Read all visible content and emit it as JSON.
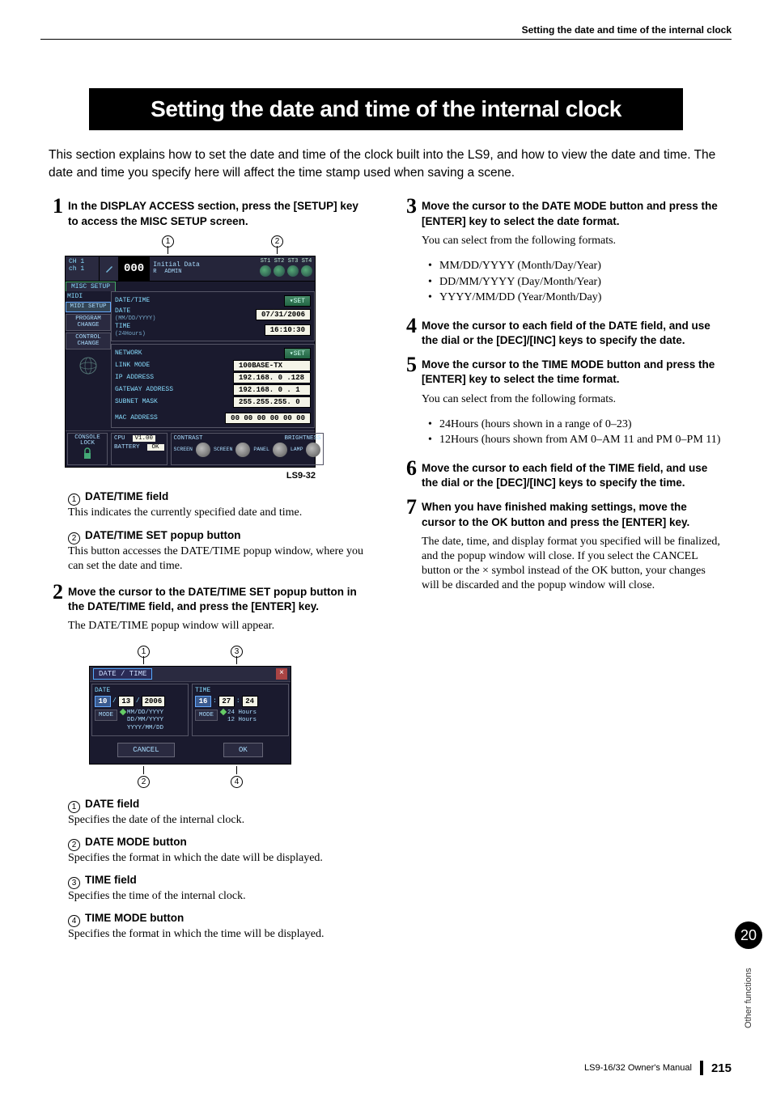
{
  "header": {
    "running": "Setting the date and time of the internal clock"
  },
  "title": "Setting the date and time of the internal clock",
  "intro": "This section explains how to set the date and time of the clock built into the LS9, and how to view the date and time. The date and time you specify here will affect the time stamp used when saving a scene.",
  "left": {
    "step1": {
      "num": "1",
      "text": "In the DISPLAY ACCESS section, press the [SETUP] key to access the MISC SETUP screen."
    },
    "fig1_caption": "LS9-32",
    "fig1": {
      "ch_a": "CH 1",
      "ch_b": "ch 1",
      "num": "000",
      "initial": "Initial Data",
      "r": "R",
      "admin": "ADMIN",
      "st_labels": [
        "ST1",
        "ST2",
        "ST3",
        "ST4"
      ],
      "tab": "MISC SETUP",
      "sidebar": [
        "MIDI",
        "MIDI SETUP",
        "PROGRAM CHANGE",
        "CONTROL CHANGE"
      ],
      "grp_dt": {
        "title": "DATE/TIME",
        "date_lbl": "DATE",
        "date_fmt": "(MM/DD/YYYY)",
        "date_val": "07/31/2006",
        "time_lbl": "TIME",
        "time_fmt": "(24Hours)",
        "time_val": "16:10:30",
        "set": "▾SET"
      },
      "grp_net": {
        "title": "NETWORK",
        "link": "LINK MODE",
        "link_val": "100BASE-TX",
        "ip": "IP ADDRESS",
        "ip_val": "192.168. 0 .128",
        "gw": "GATEWAY ADDRESS",
        "gw_val": "192.168. 0 . 1",
        "sub": "SUBNET MASK",
        "sub_val": "255.255.255. 0",
        "mac": "MAC ADDRESS",
        "mac_val": "00 00 00 00 00 00",
        "set": "▾SET"
      },
      "bottom": {
        "console_lock": "CONSOLE LOCK",
        "cpu": "CPU",
        "cpu_val": "V1.00",
        "battery": "BATTERY",
        "battery_val": "OK",
        "contrast": "CONTRAST",
        "brightness": "BRIGHTNESS",
        "screen": "SCREEN",
        "screen2": "SCREEN",
        "panel": "PANEL",
        "lamp": "LAMP"
      }
    },
    "c1": {
      "n": "1",
      "title": "DATE/TIME field",
      "body": "This indicates the currently specified date and time."
    },
    "c2": {
      "n": "2",
      "title": "DATE/TIME SET popup button",
      "body": "This button accesses the DATE/TIME popup window, where you can set the date and time."
    },
    "step2": {
      "num": "2",
      "text": "Move the cursor to the DATE/TIME SET popup button in the DATE/TIME field, and press the [ENTER] key."
    },
    "step2_body": "The DATE/TIME popup window will appear.",
    "fig2": {
      "title": "DATE / TIME",
      "date_lbl": "DATE",
      "time_lbl": "TIME",
      "date": {
        "mm": "10",
        "dd": "13",
        "yyyy": "2006"
      },
      "time": {
        "h": "16",
        "m": "27",
        "s": "24"
      },
      "mode": "MODE",
      "date_opts": [
        "MM/DD/YYYY",
        "DD/MM/YYYY",
        "YYYY/MM/DD"
      ],
      "time_opts": [
        "24 Hours",
        "12 Hours"
      ],
      "cancel": "CANCEL",
      "ok": "OK"
    },
    "d1": {
      "n": "1",
      "title": "DATE field",
      "body": "Specifies the date of the internal clock."
    },
    "d2": {
      "n": "2",
      "title": "DATE MODE button",
      "body": "Specifies the format in which the date will be displayed."
    },
    "d3": {
      "n": "3",
      "title": "TIME field",
      "body": "Specifies the time of the internal clock."
    },
    "d4": {
      "n": "4",
      "title": "TIME MODE button",
      "body": "Specifies the format in which the time will be displayed."
    }
  },
  "right": {
    "step3": {
      "num": "3",
      "text": "Move the cursor to the DATE MODE button and press the [ENTER] key to select the date format."
    },
    "step3_body": "You can select from the following formats.",
    "step3_bullets": [
      "MM/DD/YYYY (Month/Day/Year)",
      "DD/MM/YYYY (Day/Month/Year)",
      "YYYY/MM/DD (Year/Month/Day)"
    ],
    "step4": {
      "num": "4",
      "text": "Move the cursor to each field of the DATE field, and use the dial or the [DEC]/[INC] keys to specify the date."
    },
    "step5": {
      "num": "5",
      "text": "Move the cursor to the TIME MODE button and press the [ENTER] key to select the time format."
    },
    "step5_body": "You can select from the following formats.",
    "step5_bullets": [
      "24Hours (hours shown in a range of 0–23)",
      "12Hours (hours shown from AM 0–AM 11 and PM 0–PM 11)"
    ],
    "step6": {
      "num": "6",
      "text": "Move the cursor to each field of the TIME field, and use the dial or the [DEC]/[INC] keys to specify the time."
    },
    "step7": {
      "num": "7",
      "text": "When you have finished making settings, move the cursor to the OK button and press the [ENTER] key."
    },
    "step7_body": "The date, time, and display format you specified will be finalized, and the popup window will close. If you select the CANCEL button or the × symbol instead of the OK button, your changes will be discarded and the popup window will close."
  },
  "side": {
    "chapter": "20",
    "label": "Other functions"
  },
  "footer": {
    "manual": "LS9-16/32  Owner's Manual",
    "page": "215"
  }
}
